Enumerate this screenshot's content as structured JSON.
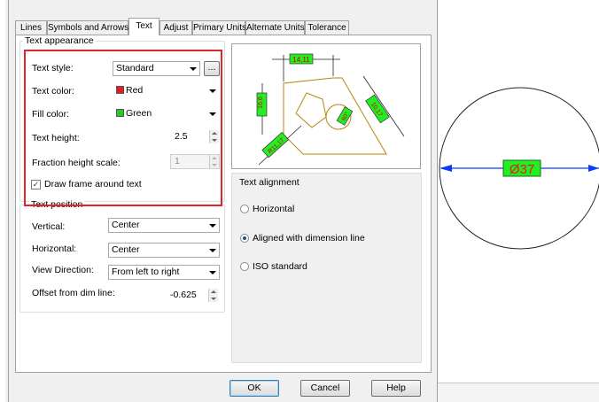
{
  "tabs": [
    {
      "label": "Lines",
      "active": false
    },
    {
      "label": "Symbols and Arrows",
      "active": false
    },
    {
      "label": "Text",
      "active": true
    },
    {
      "label": "Adjust",
      "active": false
    },
    {
      "label": "Primary Units",
      "active": false
    },
    {
      "label": "Alternate Units",
      "active": false
    },
    {
      "label": "Tolerance",
      "active": false
    }
  ],
  "text_appearance": {
    "title": "Text appearance",
    "text_style_label": "Text style:",
    "text_style_value": "Standard",
    "text_style_button": "...",
    "text_color_label": "Text color:",
    "text_color_value": "Red",
    "text_color_swatch": "#e02020",
    "fill_color_label": "Fill color:",
    "fill_color_value": "Green",
    "fill_color_swatch": "#22cc22",
    "text_height_label": "Text height:",
    "text_height_value": "2.5",
    "fraction_label": "Fraction height scale:",
    "fraction_value": "1",
    "draw_frame_label": "Draw frame around text",
    "draw_frame_checked": true
  },
  "text_position": {
    "title": "Text position",
    "vertical_label": "Vertical:",
    "vertical_value": "Center",
    "horizontal_label": "Horizontal:",
    "horizontal_value": "Center",
    "view_direction_label": "View Direction:",
    "view_direction_value": "From left to right",
    "offset_label": "Offset from dim line:",
    "offset_value": "-0.625"
  },
  "text_alignment": {
    "title": "Text alignment",
    "options": [
      {
        "label": "Horizontal",
        "checked": false
      },
      {
        "label": "Aligned with dimension line",
        "checked": true
      },
      {
        "label": "ISO standard",
        "checked": false
      }
    ]
  },
  "preview": {
    "top_dim": "14,11",
    "left_dim": "16,6",
    "right_dim": "10,17",
    "angle_dim": "60°",
    "diag_dim": "R11,17"
  },
  "buttons": {
    "ok": "OK",
    "cancel": "Cancel",
    "help": "Help"
  },
  "drawing": {
    "dimension_text": "Ø37"
  },
  "colors": {
    "highlight": "#e0242c",
    "dim_fill": "#22ee22",
    "dim_line": "#0a3cff",
    "preview_geometry": "#b8860b"
  }
}
